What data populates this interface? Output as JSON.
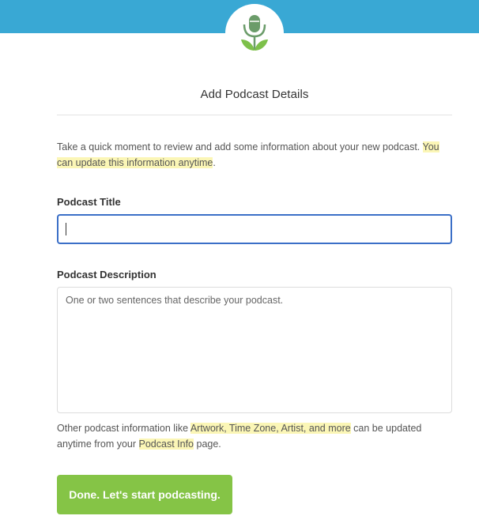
{
  "header": {
    "logo_icon": "podcast-microphone-sprout-icon",
    "colors": {
      "bar": "#39a8d4",
      "mic": "#6b9c6a",
      "leaves": "#7dc04a"
    }
  },
  "page": {
    "title": "Add Podcast Details"
  },
  "intro": {
    "text_before": "Take a quick moment to review and add some information about your new podcast. ",
    "highlight": "You can update this information anytime",
    "text_after": "."
  },
  "form": {
    "title_label": "Podcast Title",
    "title_value": "",
    "description_label": "Podcast Description",
    "description_placeholder": "One or two sentences that describe your podcast.",
    "description_value": ""
  },
  "other_info": {
    "text_1": "Other podcast information like ",
    "highlight_1": "Artwork, Time Zone, Artist, and more",
    "text_2": " can be updated anytime from your ",
    "link": "Podcast Info",
    "text_3": " page."
  },
  "actions": {
    "done_label": "Done. Let's start podcasting.",
    "done_color": "#85c446"
  },
  "colors": {
    "highlight": "#fbf6b6",
    "focus_border": "#3b6fc7"
  }
}
